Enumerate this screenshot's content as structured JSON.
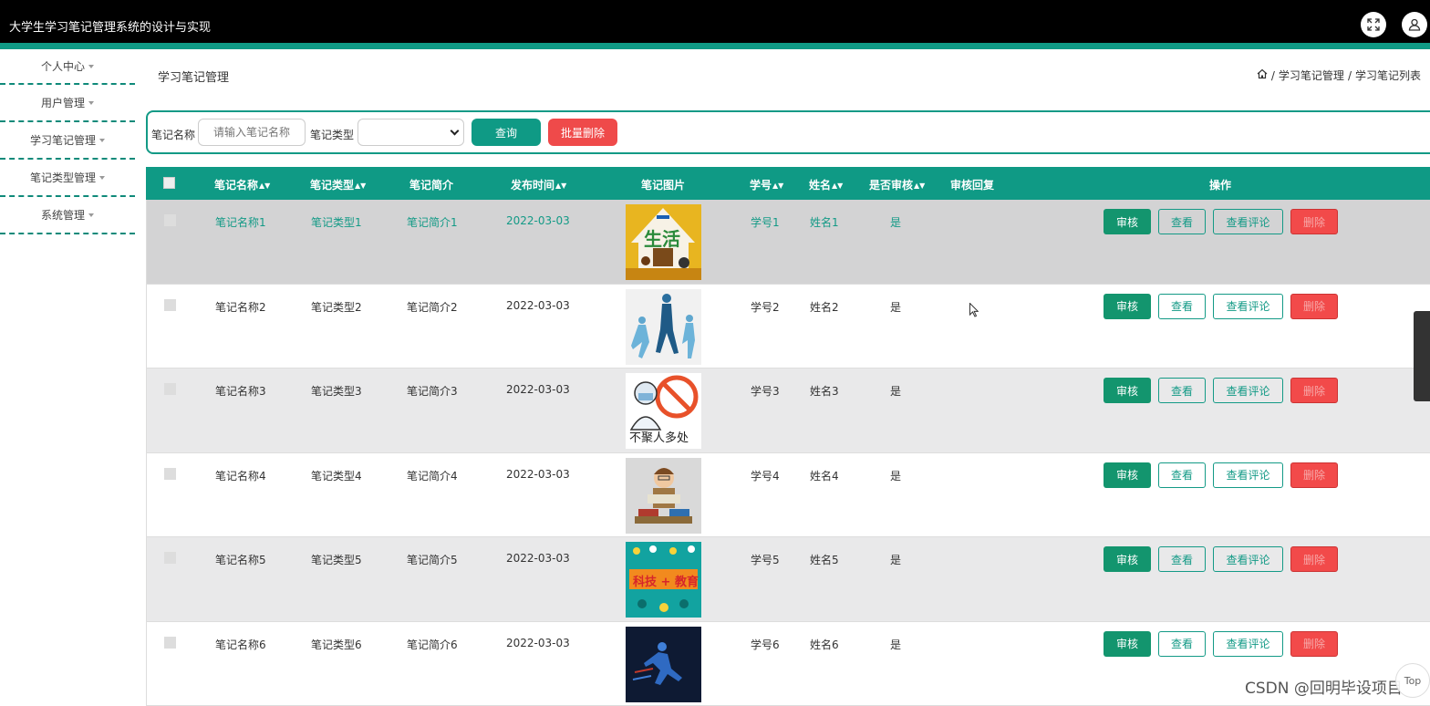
{
  "app": {
    "title": "大学生学习笔记管理系统的设计与实现"
  },
  "colors": {
    "accent": "#0f9a85",
    "danger": "#ef4a4a",
    "topbar": "#000000"
  },
  "sidebar": {
    "items": [
      {
        "label": "个人中心"
      },
      {
        "label": "用户管理"
      },
      {
        "label": "学习笔记管理"
      },
      {
        "label": "笔记类型管理"
      },
      {
        "label": "系统管理"
      }
    ]
  },
  "page": {
    "title": "学习笔记管理",
    "breadcrumb": [
      "学习笔记管理",
      "学习笔记列表"
    ],
    "breadcrumb_sep": "/"
  },
  "search": {
    "name_label": "笔记名称",
    "name_placeholder": "请输入笔记名称",
    "type_label": "笔记类型",
    "type_value": "",
    "query_label": "查询",
    "batch_delete_label": "批量删除"
  },
  "table": {
    "headers": [
      "笔记名称",
      "笔记类型",
      "笔记简介",
      "发布时间",
      "笔记图片",
      "学号",
      "姓名",
      "是否审核",
      "审核回复",
      "操作"
    ],
    "actions": {
      "audit": "审核",
      "view": "查看",
      "comments": "查看评论",
      "delete": "删除"
    },
    "rows": [
      {
        "name": "笔记名称1",
        "type": "笔记类型1",
        "intro": "笔记简介1",
        "date": "2022-03-03",
        "image": "life-poster-icon",
        "sid": "学号1",
        "sname": "姓名1",
        "audited": "是",
        "reply": ""
      },
      {
        "name": "笔记名称2",
        "type": "笔记类型2",
        "intro": "笔记简介2",
        "date": "2022-03-03",
        "image": "silhouettes-icon",
        "sid": "学号2",
        "sname": "姓名2",
        "audited": "是",
        "reply": ""
      },
      {
        "name": "笔记名称3",
        "type": "笔记类型3",
        "intro": "笔记简介3",
        "date": "2022-03-03",
        "image": "no-gathering-icon",
        "sid": "学号3",
        "sname": "姓名3",
        "audited": "是",
        "reply": ""
      },
      {
        "name": "笔记名称4",
        "type": "笔记类型4",
        "intro": "笔记简介4",
        "date": "2022-03-03",
        "image": "reader-cartoon-icon",
        "sid": "学号4",
        "sname": "姓名4",
        "audited": "是",
        "reply": ""
      },
      {
        "name": "笔记名称5",
        "type": "笔记类型5",
        "intro": "笔记简介5",
        "date": "2022-03-03",
        "image": "tech-education-icon",
        "sid": "学号5",
        "sname": "姓名5",
        "audited": "是",
        "reply": ""
      },
      {
        "name": "笔记名称6",
        "type": "笔记类型6",
        "intro": "笔记简介6",
        "date": "2022-03-03",
        "image": "runner-icon",
        "sid": "学号6",
        "sname": "姓名6",
        "audited": "是",
        "reply": ""
      }
    ]
  },
  "image_text": {
    "life": "生活",
    "no_gathering": "不聚人多处",
    "tech_edu": "科技 + 教育"
  },
  "watermark": "CSDN @回明毕设项目",
  "back_to_top": "Top"
}
